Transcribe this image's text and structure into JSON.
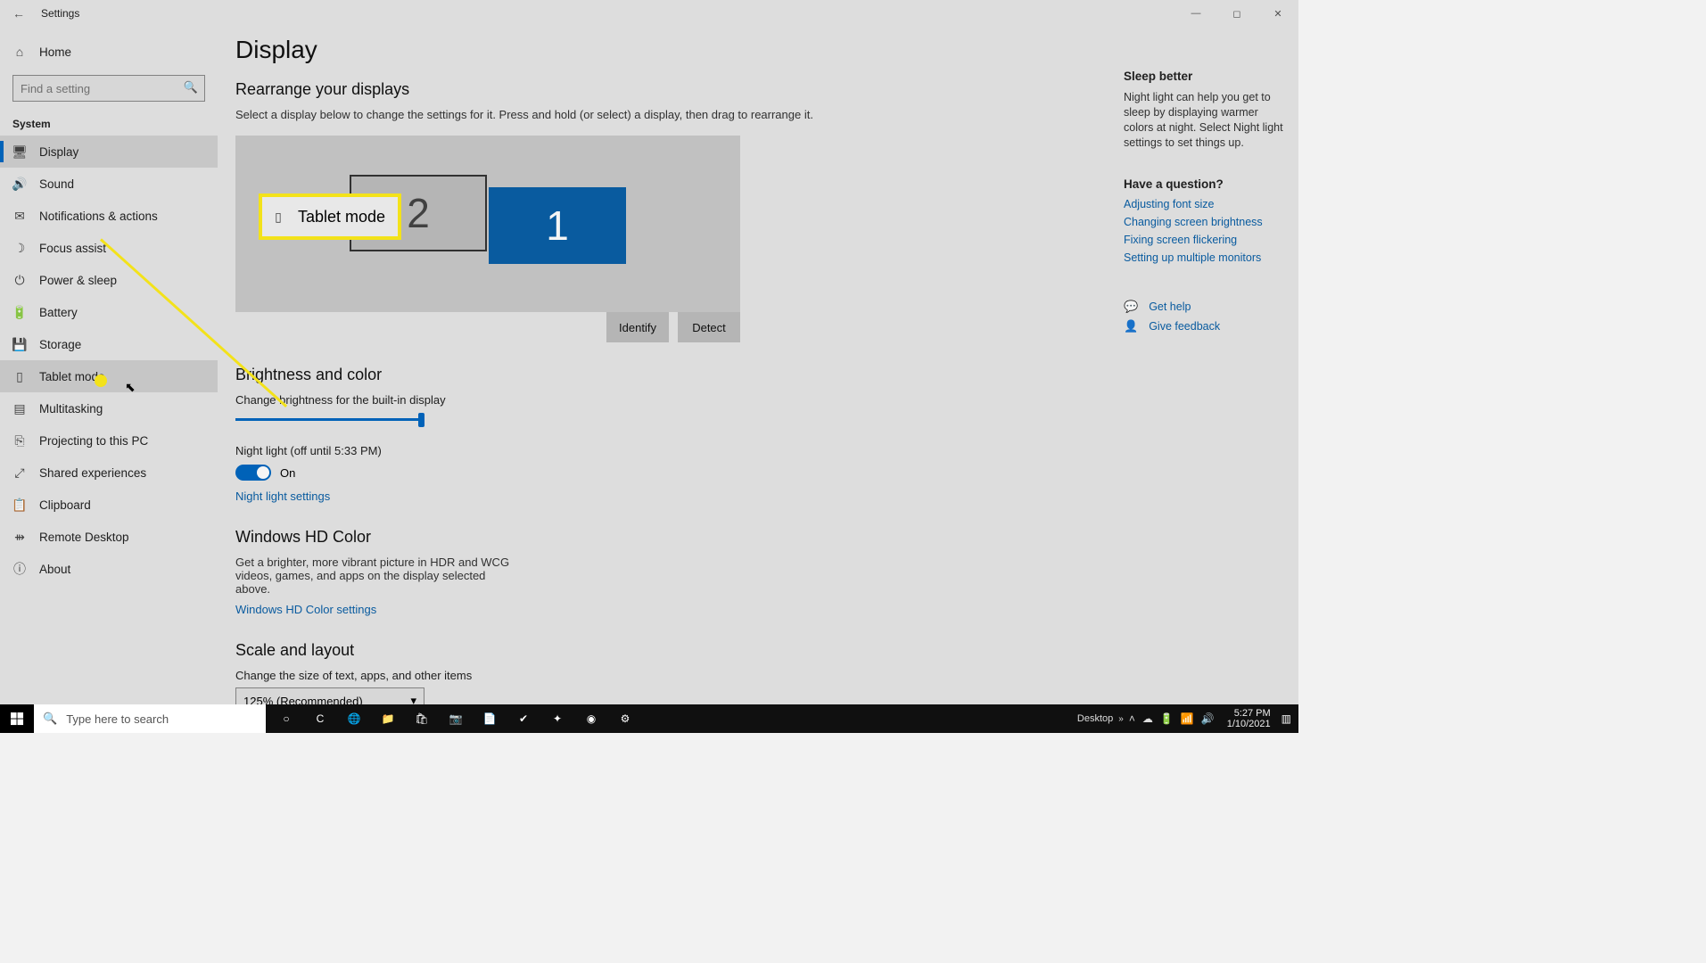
{
  "titlebar": {
    "app_name": "Settings"
  },
  "sidebar": {
    "home_label": "Home",
    "search_placeholder": "Find a setting",
    "section_label": "System",
    "items": [
      {
        "label": "Display",
        "icon": "display"
      },
      {
        "label": "Sound",
        "icon": "sound"
      },
      {
        "label": "Notifications & actions",
        "icon": "notifications"
      },
      {
        "label": "Focus assist",
        "icon": "focus"
      },
      {
        "label": "Power & sleep",
        "icon": "power"
      },
      {
        "label": "Battery",
        "icon": "battery"
      },
      {
        "label": "Storage",
        "icon": "storage"
      },
      {
        "label": "Tablet mode",
        "icon": "tablet"
      },
      {
        "label": "Multitasking",
        "icon": "multitask"
      },
      {
        "label": "Projecting to this PC",
        "icon": "project"
      },
      {
        "label": "Shared experiences",
        "icon": "shared"
      },
      {
        "label": "Clipboard",
        "icon": "clipboard"
      },
      {
        "label": "Remote Desktop",
        "icon": "remote"
      },
      {
        "label": "About",
        "icon": "about"
      }
    ]
  },
  "page": {
    "title": "Display",
    "rearrange_title": "Rearrange your displays",
    "rearrange_desc": "Select a display below to change the settings for it. Press and hold (or select) a display, then drag to rearrange it.",
    "display_2": "2",
    "display_1": "1",
    "identify_btn": "Identify",
    "detect_btn": "Detect",
    "brightness_title": "Brightness and color",
    "brightness_label": "Change brightness for the built-in display",
    "night_light_label": "Night light (off until 5:33 PM)",
    "night_light_state": "On",
    "night_light_link": "Night light settings",
    "hd_title": "Windows HD Color",
    "hd_desc": "Get a brighter, more vibrant picture in HDR and WCG videos, games, and apps on the display selected above.",
    "hd_link": "Windows HD Color settings",
    "scale_title": "Scale and layout",
    "scale_label": "Change the size of text, apps, and other items",
    "scale_value": "125% (Recommended)"
  },
  "right_pane": {
    "sleep_title": "Sleep better",
    "sleep_desc": "Night light can help you get to sleep by displaying warmer colors at night. Select Night light settings to set things up.",
    "question_title": "Have a question?",
    "links": [
      "Adjusting font size",
      "Changing screen brightness",
      "Fixing screen flickering",
      "Setting up multiple monitors"
    ],
    "get_help": "Get help",
    "give_feedback": "Give feedback"
  },
  "callout": {
    "label": "Tablet mode"
  },
  "taskbar": {
    "search_placeholder": "Type here to search",
    "desktop_label": "Desktop",
    "time": "5:27 PM",
    "date": "1/10/2021"
  }
}
